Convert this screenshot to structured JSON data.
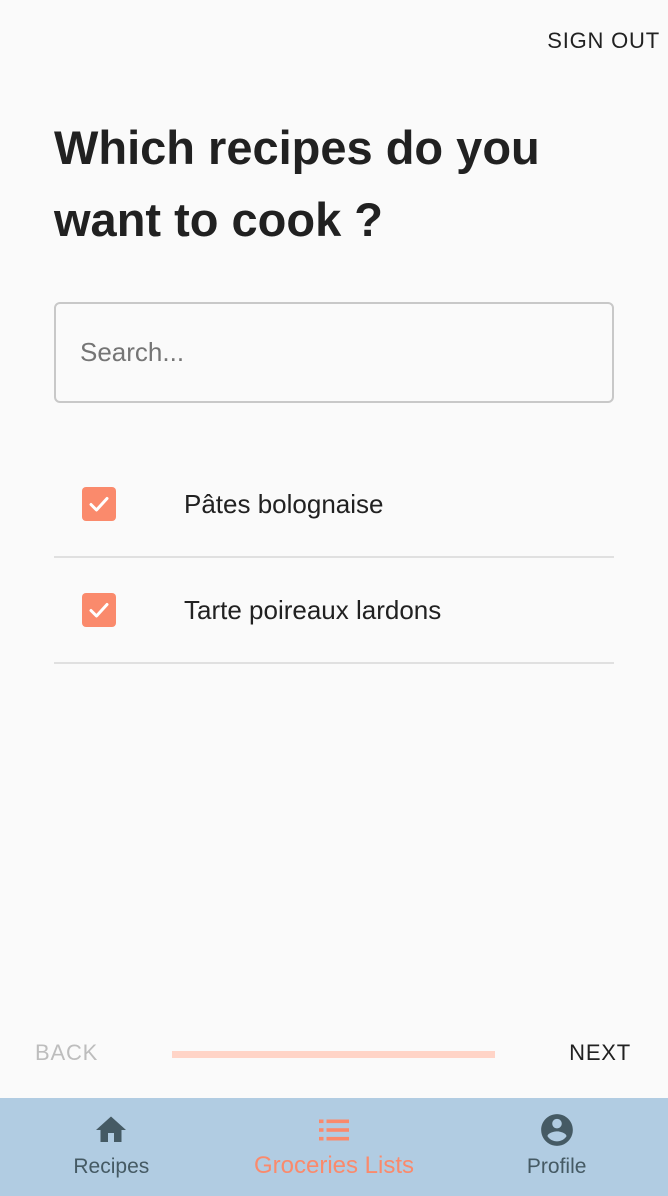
{
  "header": {
    "signout_label": "SIGN OUT"
  },
  "page": {
    "title": "Which recipes do you want to cook ?"
  },
  "search": {
    "placeholder": "Search...",
    "value": ""
  },
  "recipes": [
    {
      "label": "Pâtes bolognaise",
      "checked": true
    },
    {
      "label": "Tarte poireaux lardons",
      "checked": true
    }
  ],
  "stepper": {
    "back_label": "BACK",
    "next_label": "NEXT",
    "progress": 1.0
  },
  "bottom_nav": {
    "items": [
      {
        "label": "Recipes",
        "icon": "home-icon",
        "active": false
      },
      {
        "label": "Groceries Lists",
        "icon": "list-icon",
        "active": true
      },
      {
        "label": "Profile",
        "icon": "account-circle-icon",
        "active": false
      }
    ]
  },
  "colors": {
    "accent": "#fa8a6c",
    "progress_track": "#ffd4c7",
    "nav_background": "#b1cce2",
    "nav_inactive": "#455a64"
  }
}
